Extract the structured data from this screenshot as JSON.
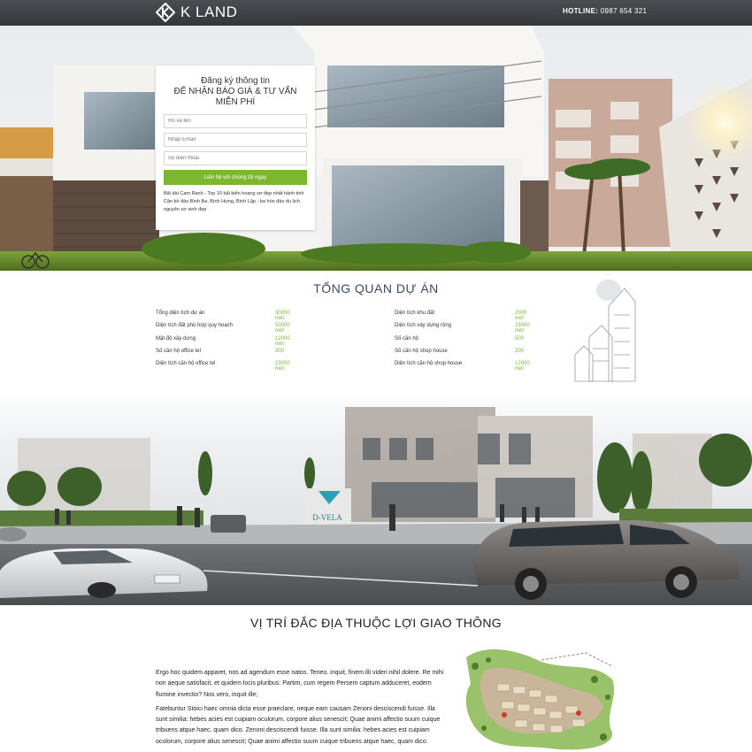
{
  "header": {
    "logo_text": "K LAND",
    "hotline_label": "HOTLINE:",
    "hotline_number": "0987 654 321"
  },
  "form": {
    "title_line1": "Đăng ký thông tin",
    "title_line2": "ĐỂ NHẬN BÁO GIÁ & TƯ VẤN MIỄN PHÍ",
    "name_placeholder": "Họ và tên",
    "email_placeholder": "Nhập Email",
    "phone_placeholder": "Số điện thoại",
    "submit_label": "Liên hệ với chúng tôi ngay",
    "description": "Bãi dài Cam Ranh - Top 10 bãi biển hoang sơ đẹp nhất hành tinh Cận kề đảo Bình Ba, Bình Hưng, Bình Lập - ba hòn đảo du lịch nguyên sơ xinh đẹp"
  },
  "overview": {
    "title": "TỔNG QUAN DỰ ÁN",
    "left": [
      {
        "label": "Tổng diện tích dự án",
        "value": "30000 mét"
      },
      {
        "label": "Diện tích đất phù hợp quy hoạch",
        "value": "50000 mét"
      },
      {
        "label": "Mật độ xây dựng",
        "value": "12000 mét"
      },
      {
        "label": "Số căn hộ office tel",
        "value": "300"
      },
      {
        "label": "Diện tích căn hộ office tel",
        "value": "23000 mét"
      }
    ],
    "right": [
      {
        "label": "Diện tích khu đất",
        "value": "2000 mét"
      },
      {
        "label": "Diện tích xây dựng rộng",
        "value": "23000 mét"
      },
      {
        "label": "Số căn hộ",
        "value": "500"
      },
      {
        "label": "Số căn hộ shop house",
        "value": "200"
      },
      {
        "label": "Diện tích căn hộ shop house",
        "value": "12000 mét"
      }
    ]
  },
  "street": {
    "sign_text": "D-VELA"
  },
  "location": {
    "title": "VỊ TRÍ ĐẮC ĐỊA THUỘC LỢI GIAO THÔNG",
    "paragraph1": "Ergo hoc quidem apparet, nos ad agendum esse natos. Teneo, inquit, finem illi videri nihil dolere. Re mihi non aeque satisfacit, et quidem locis pluribus. Partim, cum regem Persem captum adduceret, eodem flumine invectio? Nos vero, inquit ille;",
    "paragraph2": "Fatebuntur Stoici haec omnia dicta esse praeclare, neque eam causam Zenoni desciscendi fuisse. Illa sunt similia: hebes acies est cuipiam oculorum, corpore alius senescit; Quae animi affectio suum cuique tribuens atque haec, quam dico. Zenoni desciscendi fuisse. Illa sunt similia: hebes acies est cuipiam oculorum, corpore alius senescit; Quae animi affectio suum cuique tribuens atque haec, quam dico."
  }
}
